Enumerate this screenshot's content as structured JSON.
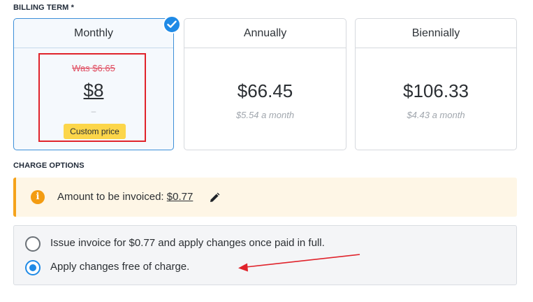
{
  "billing": {
    "label": "BILLING TERM *",
    "monthly": {
      "title": "Monthly",
      "was_price": "Was $6.65",
      "price": "$8",
      "sub": "–",
      "custom_badge": "Custom price",
      "selected": true
    },
    "annually": {
      "title": "Annually",
      "price": "$66.45",
      "sub": "$5.54 a month"
    },
    "biennially": {
      "title": "Biennially",
      "price": "$106.33",
      "sub": "$4.43 a month"
    }
  },
  "charge": {
    "label": "CHARGE OPTIONS",
    "alert_prefix": "Amount to be invoiced: ",
    "alert_amount": "$0.77",
    "options": [
      {
        "label": "Issue invoice for $0.77 and apply changes once paid in full.",
        "selected": false
      },
      {
        "label": "Apply changes free of charge.",
        "selected": true
      }
    ]
  },
  "colors": {
    "accent": "#1f8ae6",
    "warning": "#f39c12",
    "annotation": "#e0232b",
    "badge": "#fcd64a"
  },
  "icons": [
    "check-icon",
    "info-icon",
    "pencil-icon",
    "annotation-arrow"
  ]
}
